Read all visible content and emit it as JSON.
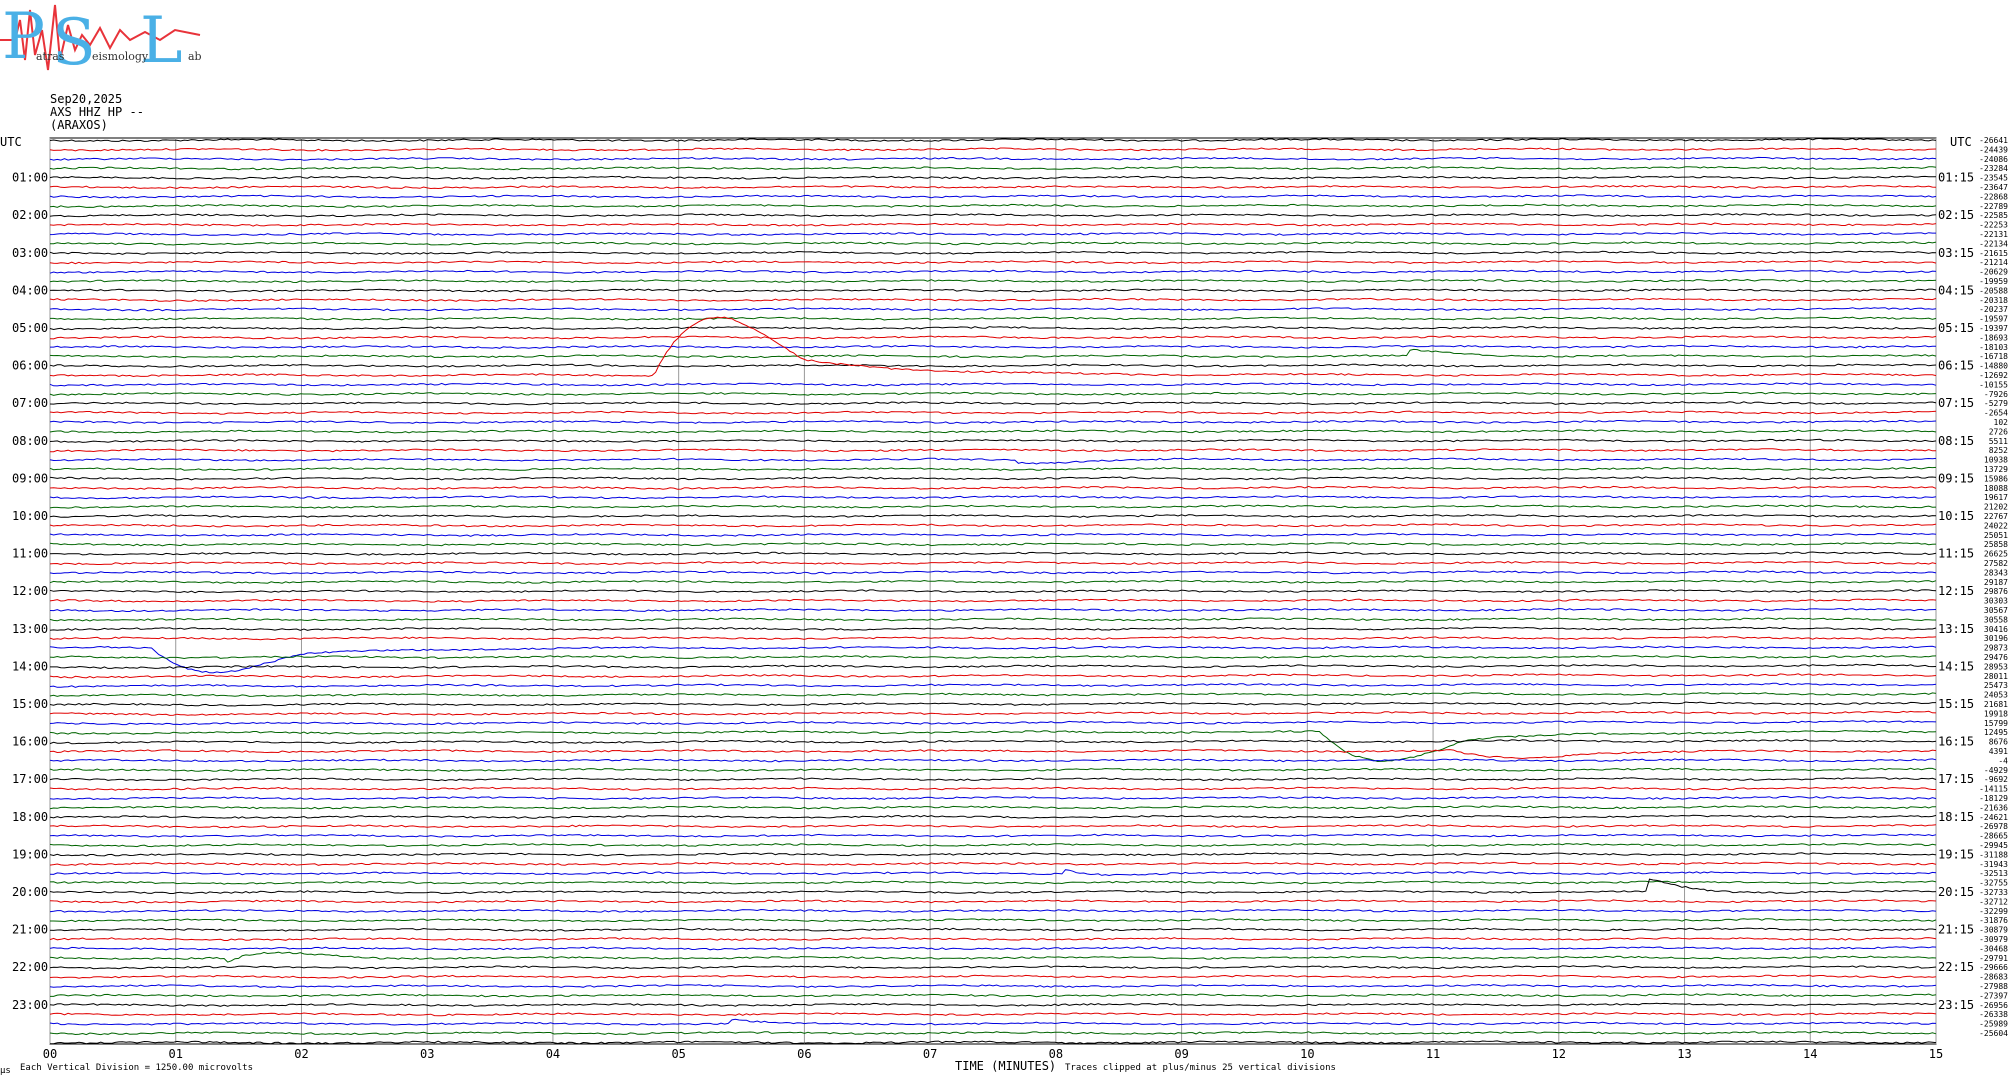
{
  "logo": {
    "letters": [
      "P",
      "S",
      "L"
    ],
    "small_texts": [
      "atras",
      "eismology",
      "ab"
    ],
    "colors": {
      "letters": "#4ab0e6",
      "scribble": "#e8333a"
    }
  },
  "header": {
    "date": "Sep20,2025",
    "station": "AXS HHZ HP --",
    "location": "(ARAXOS)",
    "utc_left": "UTC",
    "utc_right": "UTC"
  },
  "footer": {
    "division": "Each Vertical Division = 1250.00 microvolts",
    "xlabel": "TIME (MINUTES)",
    "clip": "Traces clipped at plus/minus 25 vertical divisions",
    "corner_mark": "μs"
  },
  "chart_data": {
    "type": "line",
    "title": "",
    "xlabel": "TIME (MINUTES)",
    "ylabel": "",
    "xlim": [
      0,
      15
    ],
    "x_ticks": [
      "00",
      "01",
      "02",
      "03",
      "04",
      "05",
      "06",
      "07",
      "08",
      "09",
      "10",
      "11",
      "12",
      "13",
      "14",
      "15"
    ],
    "rows_per_hour": 4,
    "row_count": 97,
    "trace_colors": [
      "#000000",
      "#e00000",
      "#0000e0",
      "#006400"
    ],
    "grid": true,
    "hour_labels_left": [
      "01:00",
      "02:00",
      "03:00",
      "04:00",
      "05:00",
      "06:00",
      "07:00",
      "08:00",
      "09:00",
      "10:00",
      "11:00",
      "12:00",
      "13:00",
      "14:00",
      "15:00",
      "16:00",
      "17:00",
      "18:00",
      "19:00",
      "20:00",
      "21:00",
      "22:00",
      "23:00"
    ],
    "hour_labels_right": [
      "01:15",
      "02:15",
      "03:15",
      "04:15",
      "05:15",
      "06:15",
      "07:15",
      "08:15",
      "09:15",
      "10:15",
      "11:15",
      "12:15",
      "13:15",
      "14:15",
      "15:15",
      "16:15",
      "17:15",
      "18:15",
      "19:15",
      "20:15",
      "21:15",
      "22:15",
      "23:15"
    ],
    "row_offsets": [
      "-26641",
      "-24439",
      "-24086",
      "-23284",
      "-23545",
      "-23647",
      "-22868",
      "-22789",
      "-22585",
      "-22253",
      "-22131",
      "-22134",
      "-21615",
      "-21214",
      "-20629",
      "-19959",
      "-20588",
      "-20318",
      "-20237",
      "-19597",
      "-19397",
      "-18693",
      "-18103",
      "-16718",
      "-14880",
      "-12692",
      "-10155",
      "-7926",
      "-5279",
      "-2654",
      "102",
      "2726",
      "5511",
      "8252",
      "10938",
      "13729",
      "15986",
      "18088",
      "19617",
      "21202",
      "22767",
      "24022",
      "25051",
      "25858",
      "26625",
      "27582",
      "28343",
      "29187",
      "29876",
      "30303",
      "30567",
      "30558",
      "30416",
      "30196",
      "29873",
      "29476",
      "28953",
      "28011",
      "25473",
      "24053",
      "21681",
      "19918",
      "15799",
      "12495",
      "8676",
      "4391",
      "-4",
      "-4929",
      "-9692",
      "-14115",
      "-18129",
      "-21636",
      "-24621",
      "-26978",
      "-28665",
      "-29945",
      "-31188",
      "-31943",
      "-32513",
      "-32755",
      "-32733",
      "-32712",
      "-32299",
      "-31876",
      "-30879",
      "-30979",
      "-30468",
      "-29791",
      "-29666",
      "-28683",
      "-27988",
      "-27397",
      "-26956",
      "-26338",
      "-25989",
      "-25604",
      ""
    ],
    "events": [
      {
        "row": 25,
        "time_min": 4.8,
        "type": "long-period offset",
        "peak_div": 12.0
      },
      {
        "row": 54,
        "time_min": 0.8,
        "type": "long-period offset",
        "peak_div": -5.0
      },
      {
        "row": 63,
        "time_min": 10.1,
        "type": "long-period offset",
        "peak_div": -6.0
      },
      {
        "row": 65,
        "time_min": 11.15,
        "type": "long-period offset",
        "peak_div": -1.5
      },
      {
        "row": 23,
        "time_min": 10.8,
        "type": "local event",
        "amplitude_div": 1.0
      },
      {
        "row": 34,
        "time_min": 7.7,
        "type": "local event",
        "amplitude_div": 0.8
      },
      {
        "row": 78,
        "time_min": 8.05,
        "type": "local event",
        "amplitude_div": 1.2
      },
      {
        "row": 80,
        "time_min": 12.7,
        "type": "local event",
        "amplitude_div": 1.4
      },
      {
        "row": 87,
        "time_min": 1.4,
        "type": "earthquake",
        "amplitude_div": 2.8
      },
      {
        "row": 94,
        "time_min": 5.4,
        "type": "local event",
        "amplitude_div": 0.5
      }
    ]
  }
}
